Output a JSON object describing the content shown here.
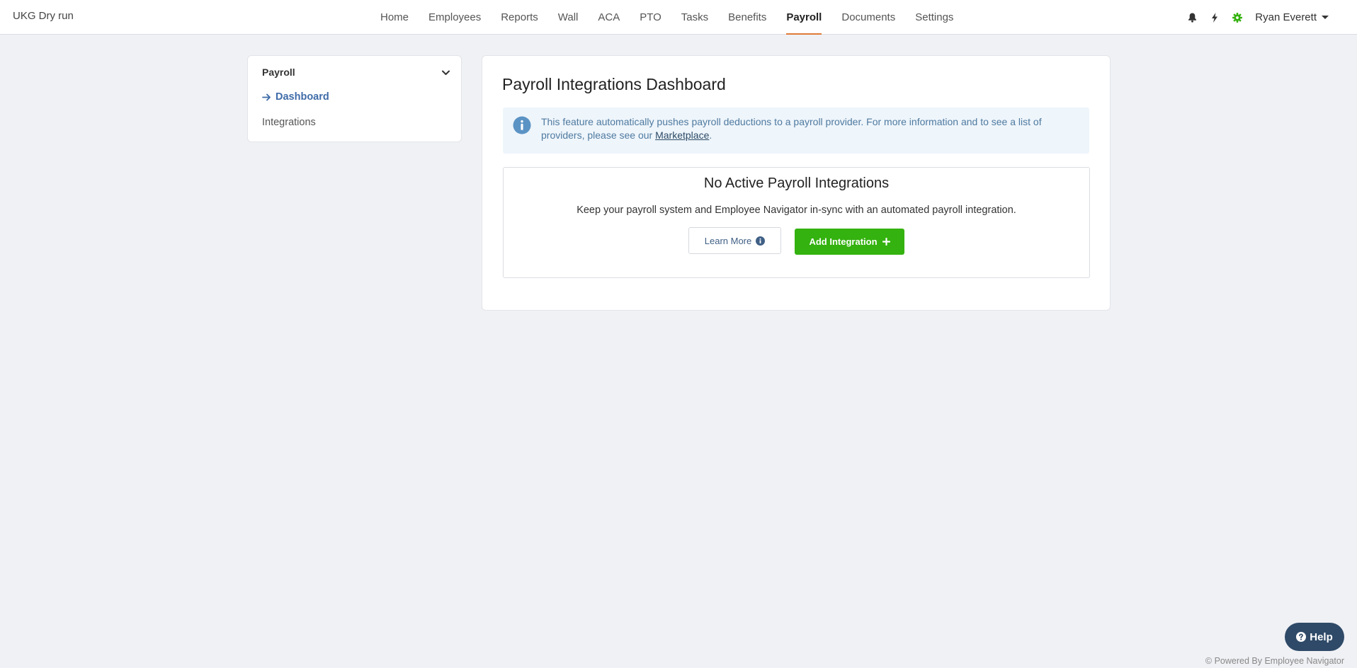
{
  "brand": "UKG Dry run",
  "nav": [
    "Home",
    "Employees",
    "Reports",
    "Wall",
    "ACA",
    "PTO",
    "Tasks",
    "Benefits",
    "Payroll",
    "Documents",
    "Settings"
  ],
  "nav_active": "Payroll",
  "user": {
    "name": "Ryan Everett"
  },
  "icons": {
    "bell": "bell-icon",
    "bolt": "lightning-icon",
    "gear": "gear-icon"
  },
  "colors": {
    "accent": "#e07b39",
    "primary_button": "#34b20f",
    "link_blue": "#3f6ca8",
    "help_button": "#2f4a68"
  },
  "sidebar": {
    "title": "Payroll",
    "items": [
      {
        "label": "Dashboard",
        "active": true
      },
      {
        "label": "Integrations",
        "active": false
      }
    ]
  },
  "main": {
    "title": "Payroll Integrations Dashboard",
    "info": {
      "text_before": "This feature automatically pushes payroll deductions to a payroll provider. For more information and to see a list of providers, please see our ",
      "link": "Marketplace",
      "text_after": "."
    },
    "empty": {
      "title": "No Active Payroll Integrations",
      "description": "Keep your payroll system and Employee Navigator in-sync with an automated payroll integration.",
      "learn_more": "Learn More",
      "add_integration": "Add Integration"
    }
  },
  "help": "Help",
  "powered": "© Powered By Employee Navigator"
}
